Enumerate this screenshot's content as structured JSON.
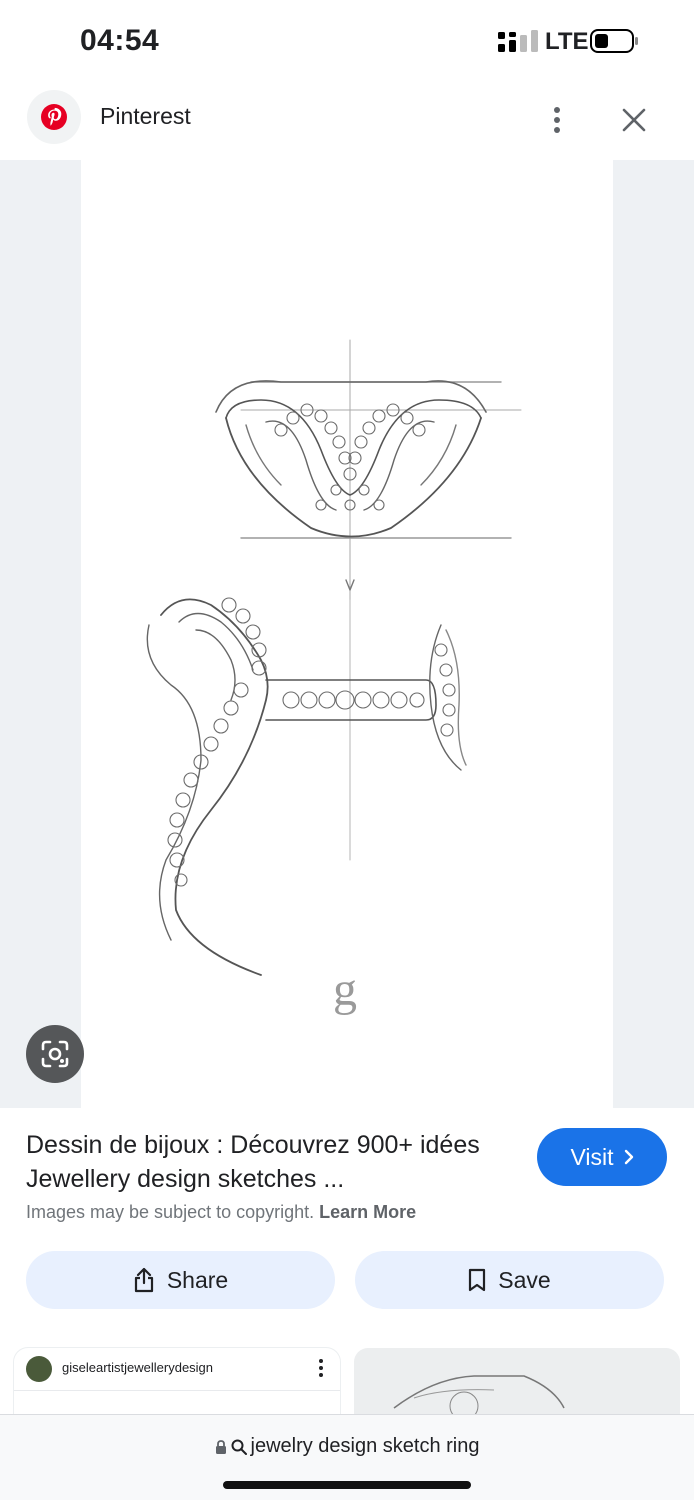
{
  "status": {
    "time": "04:54",
    "network": "LTE",
    "signal_icon": "signal-bars-icon",
    "battery_icon": "battery-low-icon"
  },
  "header": {
    "site_name": "Pinterest",
    "site_icon": "pinterest-logo-icon",
    "brand_color": "#e60023"
  },
  "image": {
    "watermark": "g",
    "lens_icon": "google-lens-icon"
  },
  "result": {
    "title": "Dessin de bijoux : Découvrez 900+ idées Jewellery design sketches ...",
    "visit_label": "Visit",
    "copyright_text": "Images may be subject to copyright.",
    "learn_more_label": "Learn More"
  },
  "actions": {
    "share_label": "Share",
    "save_label": "Save"
  },
  "related": [
    {
      "username": "giseleartistjewellerydesign"
    }
  ],
  "address_bar": {
    "query": "jewelry design sketch ring"
  },
  "colors": {
    "visit_button": "#1a73e8",
    "action_button": "#e8f0fe"
  }
}
